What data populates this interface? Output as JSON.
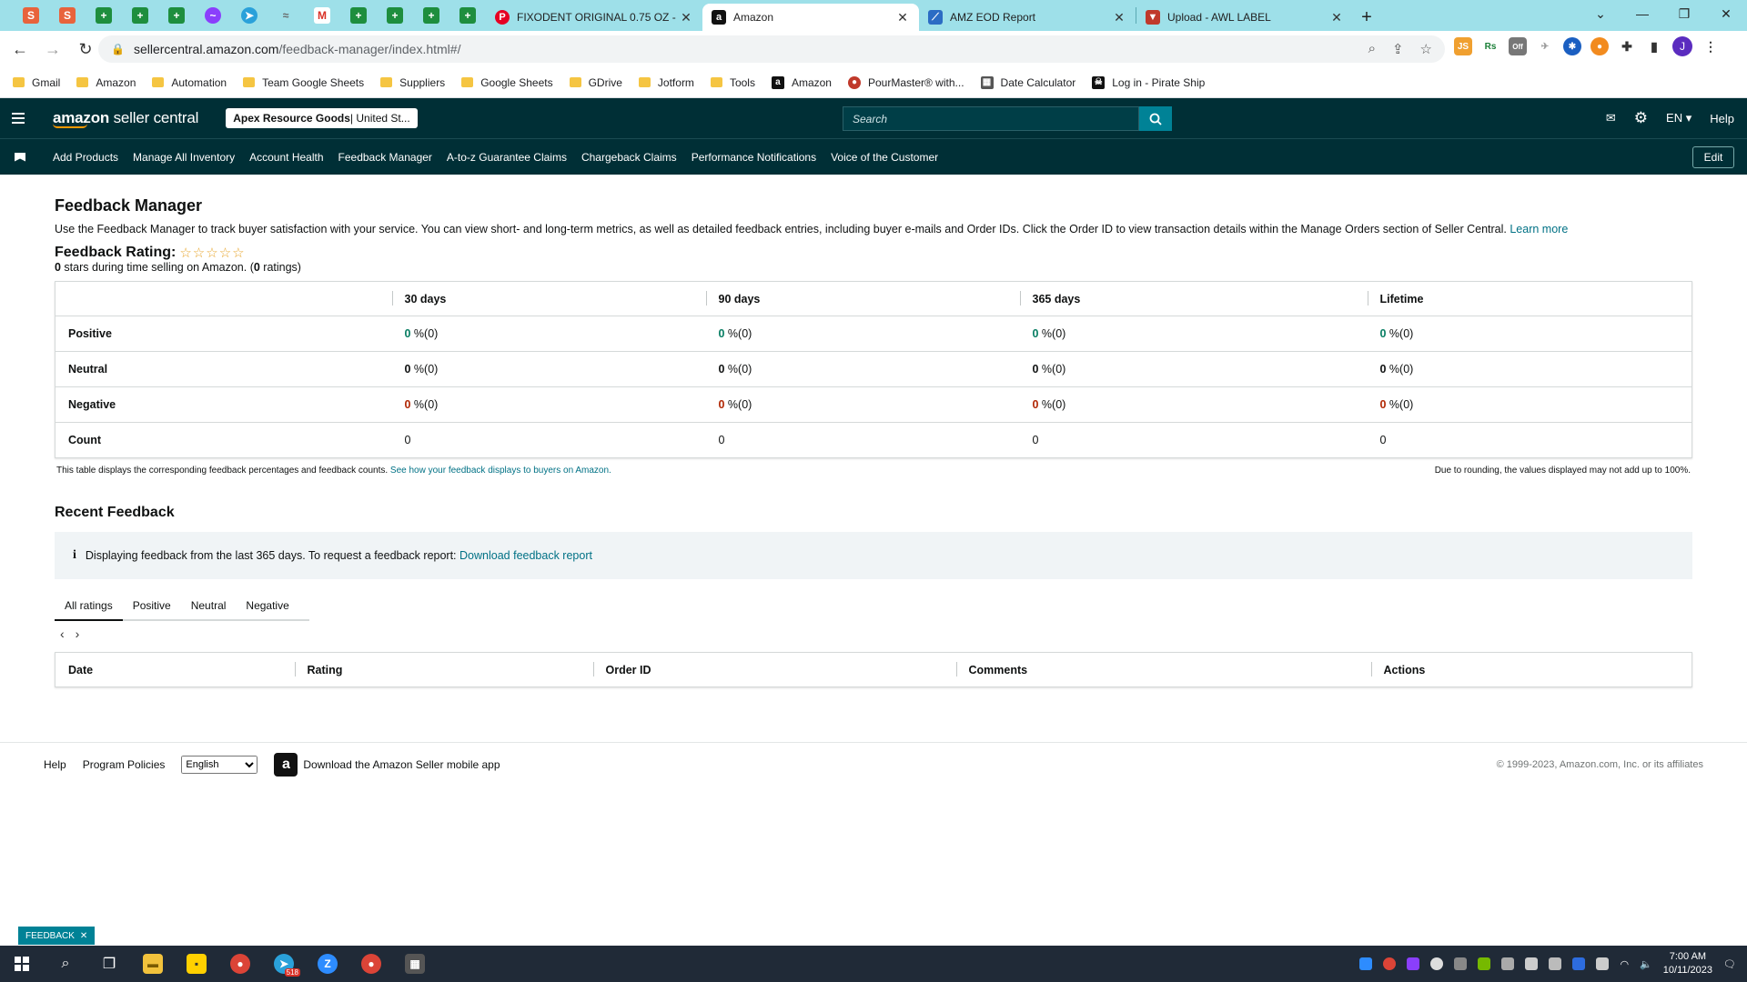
{
  "browser": {
    "tabs": [
      {
        "title": "FIXODENT ORIGINAL 0.75 OZ -",
        "favicon": "pinterest-icon",
        "color": "#e60023"
      },
      {
        "title": "Amazon",
        "favicon": "amazon-icon",
        "color": "#111111",
        "active": true
      },
      {
        "title": "AMZ EOD Report",
        "favicon": "report-icon",
        "color": "#2b6cc4"
      },
      {
        "title": "Upload - AWL LABEL",
        "favicon": "label-icon",
        "color": "#c0392b"
      }
    ],
    "url_host": "sellercentral.amazon.com",
    "url_path": "/feedback-manager/index.html#/",
    "profile_initial": "J",
    "ext_badge": "Off",
    "bookmarks": [
      {
        "label": "Gmail",
        "type": "folder"
      },
      {
        "label": "Amazon",
        "type": "folder"
      },
      {
        "label": "Automation",
        "type": "folder"
      },
      {
        "label": "Team Google Sheets",
        "type": "folder"
      },
      {
        "label": "Suppliers",
        "type": "folder"
      },
      {
        "label": "Google Sheets",
        "type": "folder"
      },
      {
        "label": "GDrive",
        "type": "folder"
      },
      {
        "label": "Jotform",
        "type": "folder"
      },
      {
        "label": "Tools",
        "type": "folder"
      },
      {
        "label": "Amazon",
        "type": "site"
      },
      {
        "label": "PourMaster® with...",
        "type": "site"
      },
      {
        "label": "Date Calculator",
        "type": "site"
      },
      {
        "label": "Log in - Pirate Ship",
        "type": "site"
      }
    ]
  },
  "header": {
    "logo_bold": "amazon",
    "logo_rest": " seller central",
    "store_name": "Apex Resource Goods",
    "store_market": " | United St...",
    "search_placeholder": "Search",
    "language": "EN ▾",
    "help": "Help"
  },
  "nav": {
    "links": [
      "Add Products",
      "Manage All Inventory",
      "Account Health",
      "Feedback Manager",
      "A-to-z Guarantee Claims",
      "Chargeback Claims",
      "Performance Notifications",
      "Voice of the Customer"
    ],
    "edit": "Edit"
  },
  "page": {
    "title": "Feedback Manager",
    "description": "Use the Feedback Manager to track buyer satisfaction with your service. You can view short- and long-term metrics, as well as detailed feedback entries, including buyer e-mails and Order IDs. Click the Order ID to view transaction details within the Manage Orders section of Seller Central.",
    "learn_more": "Learn more",
    "rating_label": "Feedback Rating:",
    "stars": "☆☆☆☆☆",
    "rating_stars_num": "0",
    "rating_sub_mid": " stars during time selling on Amazon. (",
    "rating_count": "0",
    "rating_sub_end": " ratings)"
  },
  "metrics": {
    "columns": [
      "30 days",
      "90 days",
      "365 days",
      "Lifetime"
    ],
    "rows": [
      {
        "label": "Positive",
        "cells": [
          {
            "n": "0",
            "t": " %(0)"
          },
          {
            "n": "0",
            "t": " %(0)"
          },
          {
            "n": "0",
            "t": " %(0)"
          },
          {
            "n": "0",
            "t": " %(0)"
          }
        ]
      },
      {
        "label": "Neutral",
        "cells": [
          {
            "n": "0",
            "t": " %(0)"
          },
          {
            "n": "0",
            "t": " %(0)"
          },
          {
            "n": "0",
            "t": " %(0)"
          },
          {
            "n": "0",
            "t": " %(0)"
          }
        ]
      },
      {
        "label": "Negative",
        "cells": [
          {
            "n": "0",
            "t": " %(0)"
          },
          {
            "n": "0",
            "t": " %(0)"
          },
          {
            "n": "0",
            "t": " %(0)"
          },
          {
            "n": "0",
            "t": " %(0)"
          }
        ]
      },
      {
        "label": "Count",
        "cells": [
          "0",
          "0",
          "0",
          "0"
        ]
      }
    ],
    "note_left": "This table displays the corresponding feedback percentages and feedback counts.",
    "note_left_link": "See how your feedback displays to buyers on Amazon.",
    "note_right": "Due to rounding, the values displayed may not add up to 100%."
  },
  "recent": {
    "title": "Recent Feedback",
    "info": "Displaying feedback from the last 365 days. To request a feedback report:",
    "info_link": "Download feedback report",
    "tabs": [
      "All ratings",
      "Positive",
      "Neutral",
      "Negative"
    ],
    "columns": [
      "Date",
      "Rating",
      "Order ID",
      "Comments",
      "Actions"
    ]
  },
  "footer": {
    "help": "Help",
    "policies": "Program Policies",
    "language": "English",
    "app": "Download the Amazon Seller mobile app",
    "copyright": "© 1999-2023, Amazon.com, Inc. or its affiliates",
    "feedback": "FEEDBACK"
  },
  "taskbar": {
    "telegram_badge": "518",
    "time": "7:00 AM",
    "date": "10/11/2023"
  },
  "colors": {
    "header_bg": "#002f36",
    "accent": "#008296",
    "positive": "#067d62",
    "negative": "#b12704"
  }
}
